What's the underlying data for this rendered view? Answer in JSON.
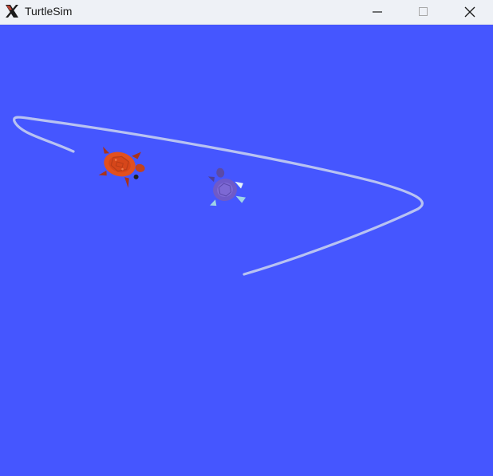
{
  "window": {
    "title": "TurtleSim",
    "icon": "x-window-icon",
    "controls": [
      "minimize-icon",
      "maximize-icon",
      "close-icon"
    ]
  },
  "canvas": {
    "background": "#4556ff",
    "pen_color": "#b8c2f2",
    "turtles": [
      {
        "name": "turtle-orange",
        "shell_color": "#e2501e"
      },
      {
        "name": "turtle-purple",
        "shell_color": "#6f5ac8"
      }
    ]
  }
}
